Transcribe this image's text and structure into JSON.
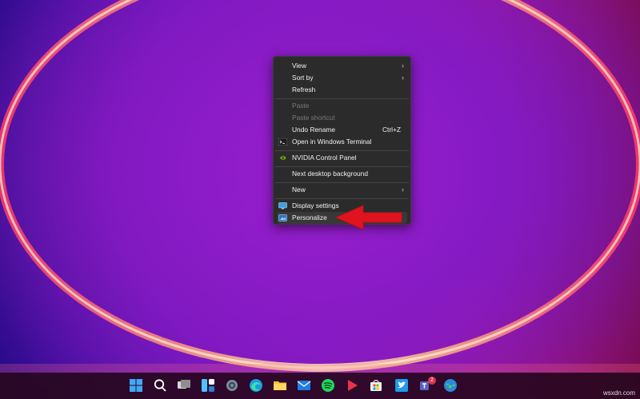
{
  "menu": {
    "items": [
      {
        "label": "View",
        "has_submenu": true,
        "icon": ""
      },
      {
        "label": "Sort by",
        "has_submenu": true,
        "icon": ""
      },
      {
        "label": "Refresh",
        "icon": ""
      },
      {
        "label": "Paste",
        "disabled": true,
        "icon": ""
      },
      {
        "label": "Paste shortcut",
        "disabled": true,
        "icon": ""
      },
      {
        "label": "Undo Rename",
        "shortcut": "Ctrl+Z",
        "icon": ""
      },
      {
        "label": "Open in Windows Terminal",
        "icon": "terminal-icon"
      },
      {
        "label": "NVIDIA Control Panel",
        "icon": "nvidia-icon"
      },
      {
        "label": "Next desktop background",
        "icon": ""
      },
      {
        "label": "New",
        "has_submenu": true,
        "icon": ""
      },
      {
        "label": "Display settings",
        "icon": "display-icon"
      },
      {
        "label": "Personalize",
        "icon": "personalize-icon"
      }
    ]
  },
  "annotation": {
    "arrow_color": "#e0141e",
    "points_to": "Personalize"
  },
  "taskbar": {
    "icons": [
      "windows-start-icon",
      "search-icon",
      "task-view-icon",
      "widgets-icon",
      "settings-gear-icon",
      "edge-icon",
      "file-explorer-icon",
      "mail-icon",
      "spotify-icon",
      "media-player-icon",
      "microsoft-store-icon",
      "twitter-icon",
      "teams-icon",
      "browser-globe-icon"
    ],
    "teams_badge": "2"
  },
  "watermark": "wsxdn.com",
  "colors": {
    "menu_bg": "#2b2b2b",
    "menu_text": "#f2f2f2",
    "disabled_text": "#7a7a7a",
    "taskbar_bg": "#28081e"
  }
}
